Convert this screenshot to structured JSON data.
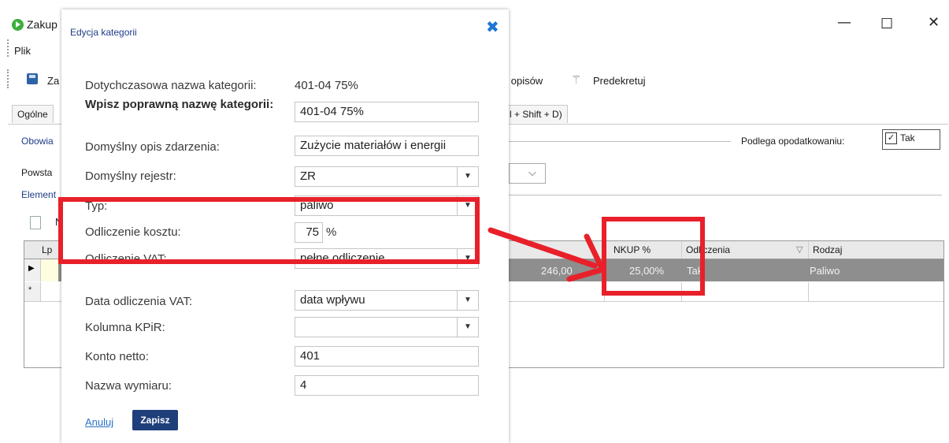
{
  "app": {
    "title": "Zakup",
    "menu": "Plik",
    "toolbar": {
      "save": "Za",
      "descriptions": "ie opisów",
      "predekretuj": "Predekretuj"
    },
    "tabs": [
      "Ogólne",
      "l + Shift + D)"
    ],
    "links": {
      "obowiazkowe": "Obowia",
      "elementy": "Element"
    },
    "powstanie": "Powsta",
    "new_label": "N",
    "podlega_label": "Podlega opodatkowaniu:",
    "podlega_value": "Tak",
    "grid": {
      "headers": [
        "Lp",
        "to",
        "NKUP %",
        "Odliczenia",
        "Rodzaj"
      ],
      "row1": {
        "netto": "246,00",
        "nkup": "25,00%",
        "odliczenia": "Tak",
        "rodzaj": "Paliwo"
      },
      "markers": {
        "current": "▶",
        "new": "*"
      }
    },
    "window_buttons": {
      "minimize": "—",
      "maximize": "☐",
      "close": "✕"
    }
  },
  "dialog": {
    "title": "Edycja kategorii",
    "close": "✖",
    "fields": {
      "prev_name_label": "Dotychczasowa nazwa kategorii:",
      "prev_name_value": "401-04 75%",
      "new_name_label": "Wpisz poprawną nazwę kategorii:",
      "new_name_value": "401-04 75%",
      "desc_label": "Domyślny opis zdarzenia:",
      "desc_value": "Zużycie materiałów i energii",
      "register_label": "Domyślny rejestr:",
      "register_value": "ZR",
      "type_label": "Typ:",
      "type_value": "paliwo",
      "cost_label": "Odliczenie kosztu:",
      "cost_value": "75",
      "cost_unit": "%",
      "vat_label": "Odliczenie VAT:",
      "vat_value": "pełne odliczenie",
      "vat_date_label": "Data odliczenia VAT:",
      "vat_date_value": "data wpływu",
      "kpir_label": "Kolumna KPiR:",
      "kpir_value": "",
      "account_label": "Konto netto:",
      "account_value": "401",
      "dimension_label": "Nazwa wymiaru:",
      "dimension_value": "4"
    },
    "buttons": {
      "cancel": "Anuluj",
      "save": "Zapisz"
    }
  },
  "annotation_color": "#e8202a"
}
